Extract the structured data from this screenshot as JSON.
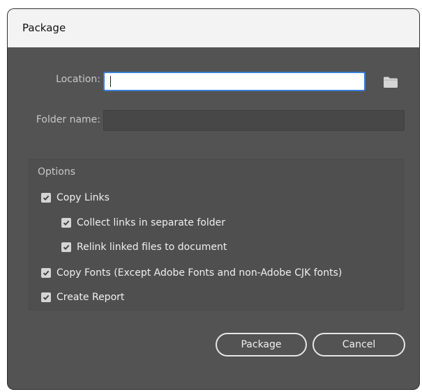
{
  "dialog": {
    "title": "Package",
    "location": {
      "label": "Location:",
      "value": "",
      "placeholder": ""
    },
    "folder_name": {
      "label": "Folder name:",
      "value": ""
    },
    "options": {
      "title": "Options",
      "items": [
        {
          "label": "Copy Links",
          "checked": true
        },
        {
          "label": "Collect links in separate folder",
          "checked": true
        },
        {
          "label": "Relink linked files to document",
          "checked": true
        },
        {
          "label": "Copy Fonts (Except Adobe Fonts and non-Adobe CJK fonts)",
          "checked": true
        },
        {
          "label": "Create Report",
          "checked": true
        }
      ]
    },
    "buttons": {
      "package": "Package",
      "cancel": "Cancel"
    }
  },
  "icons": {
    "browse": "folder-icon",
    "check": "checkmark-icon"
  },
  "colors": {
    "dialog_bg": "#535353",
    "titlebar_bg": "#f3f3f3",
    "focus_border": "#3b7fd8"
  }
}
